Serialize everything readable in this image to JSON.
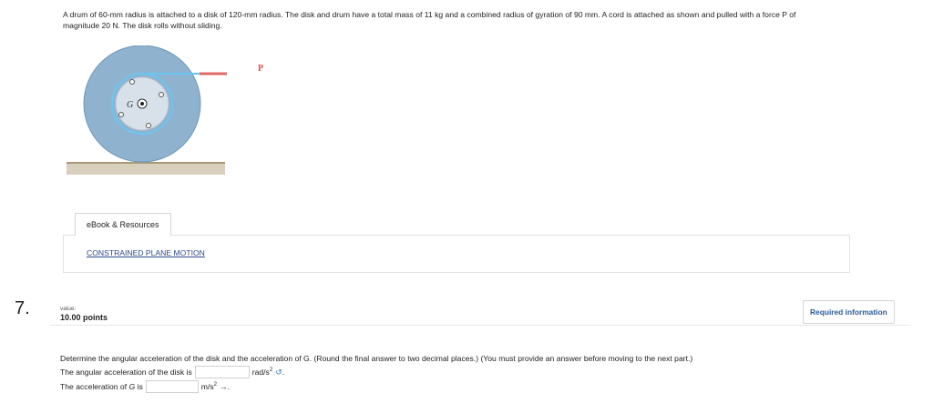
{
  "problem": {
    "line1": "A drum of 60-mm radius is attached to a disk of 120-mm radius. The disk and drum have a total mass of 11 kg and a combined radius of gyration of 90 mm. A cord is attached as shown and pulled with a force P of",
    "line2": "magnitude 20 N. The disk rolls without sliding."
  },
  "figure": {
    "force_label": "P",
    "center_label": "G"
  },
  "resources": {
    "tab_label": "eBook & Resources",
    "link_text": "CONSTRAINED PLANE MOTION"
  },
  "question": {
    "number": "7.",
    "value_label": "value:",
    "points": "10.00 points",
    "required_info": "Required information",
    "instructions": "Determine the angular acceleration of the disk and the acceleration of G. (Round the final answer to two decimal places.) (You must provide an answer before moving to the next part.)",
    "row1_label": "The angular acceleration of the disk is",
    "row1_unit": "rad/s",
    "row1_unit_exp": "2",
    "row1_input_value": "",
    "row2_label_prefix": "The acceleration of",
    "row2_label_var": "G",
    "row2_label_suffix": "is",
    "row2_unit": "m/s",
    "row2_unit_exp": "2",
    "row2_input_value": "",
    "row2_direction": "→."
  },
  "icons": {
    "counterclockwise": "counterclockwise-arrow-icon",
    "right_arrow": "right-arrow"
  },
  "colors": {
    "disk": "#8fb3cf",
    "hub": "#d4dde6",
    "cord": "#6ac6f0",
    "force": "#e06a6a",
    "ground": "#cbbfa8",
    "link": "#2a4b8c"
  }
}
